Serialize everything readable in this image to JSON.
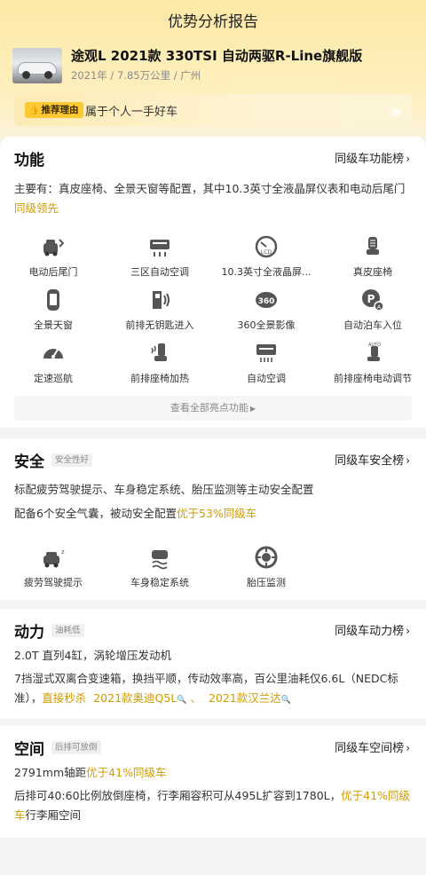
{
  "header": {
    "title": "优势分析报告"
  },
  "car": {
    "name": "途观L 2021款 330TSI 自动两驱R-Line旗舰版",
    "year": "2021年",
    "mileage": "7.85万公里",
    "city": "广州",
    "separator": " / "
  },
  "reason": {
    "tag": "推荐理由",
    "text": "属于个人一手好车"
  },
  "function": {
    "title": "功能",
    "rank_link": "同级车功能榜",
    "summary_prefix": "主要有：真皮座椅、全景天窗等配置，其中10.3英寸全液晶屏仪表和电动后尾门",
    "summary_highlight": "同级领先",
    "features": [
      {
        "label": "电动后尾门",
        "icon": "power-tailgate-icon"
      },
      {
        "label": "三区自动空调",
        "icon": "tri-zone-ac-icon"
      },
      {
        "label": "10.3英寸全液晶屏...",
        "icon": "lcd-dashboard-icon"
      },
      {
        "label": "真皮座椅",
        "icon": "leather-seat-icon"
      },
      {
        "label": "全景天窗",
        "icon": "panoramic-sunroof-icon"
      },
      {
        "label": "前排无钥匙进入",
        "icon": "keyless-entry-icon"
      },
      {
        "label": "360全景影像",
        "icon": "360-camera-icon"
      },
      {
        "label": "自动泊车入位",
        "icon": "auto-parking-icon"
      },
      {
        "label": "定速巡航",
        "icon": "cruise-control-icon"
      },
      {
        "label": "前排座椅加热",
        "icon": "seat-heating-icon"
      },
      {
        "label": "自动空调",
        "icon": "auto-ac-icon"
      },
      {
        "label": "前排座椅电动调节",
        "icon": "power-seat-adjust-icon"
      }
    ],
    "more": "查看全部亮点功能"
  },
  "safety": {
    "title": "安全",
    "tag": "安全性好",
    "rank_link": "同级车安全榜",
    "line1": "标配疲劳驾驶提示、车身稳定系统、胎压监测等主动安全配置",
    "line2_prefix": "配备6个安全气囊，被动安全配置",
    "line2_highlight": "优于53%同级车",
    "features": [
      {
        "label": "疲劳驾驶提示",
        "icon": "fatigue-alert-icon"
      },
      {
        "label": "车身稳定系统",
        "icon": "stability-control-icon"
      },
      {
        "label": "胎压监测",
        "icon": "tire-pressure-icon"
      }
    ]
  },
  "power": {
    "title": "动力",
    "tag": "油耗低",
    "rank_link": "同级车动力榜",
    "line1": "2.0T 直列4缸，涡轮增压发动机",
    "line2": "7挡湿式双离合变速箱，换挡平顺，传动效率高，百公里油耗仅6.6L（NEDC标准），",
    "compare_prefix": "直接秒杀",
    "compare1": "2021款奥迪Q5L",
    "compare_sep": "、",
    "compare2": "2021款汉兰达"
  },
  "space": {
    "title": "空间",
    "tag": "后排可放倒",
    "rank_link": "同级车空间榜",
    "line1_prefix": "2791mm轴距",
    "line1_highlight": "优于41%同级车",
    "line2_prefix": "后排可40:60比例放倒座椅，行李厢容积可从495L扩容到1780L，",
    "line2_highlight": "优于41%同级车",
    "line2_suffix": "行李厢空间"
  },
  "colors": {
    "accent": "#d29b00",
    "tag_yellow": "#ffc933"
  }
}
